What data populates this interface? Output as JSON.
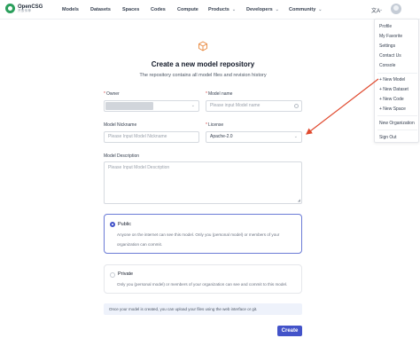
{
  "brand": {
    "name": "OpenCSG",
    "tagline": "开放传神"
  },
  "nav": {
    "items": [
      "Models",
      "Datasets",
      "Spaces",
      "Codes",
      "Compute"
    ],
    "dropdowns": [
      "Products",
      "Developers",
      "Community"
    ],
    "language_icon": "translate-icon",
    "avatar_icon": "user-avatar"
  },
  "user_menu": {
    "items": [
      "Profile",
      "My Favorite",
      "Settings",
      "Contact Us",
      "Console"
    ],
    "new_items": [
      "+ New Model",
      "+ New Dataset",
      "+ New Code",
      "+ New Space"
    ],
    "org_item": "New Organization",
    "signout": "Sign Out"
  },
  "page": {
    "icon": "cube-icon",
    "title": "Create a new model repository",
    "subtitle": "The repository contains all model files and revision history"
  },
  "form": {
    "owner": {
      "label": "Owner",
      "required_mark": "*"
    },
    "model_name": {
      "label": "Model name",
      "required_mark": "*",
      "placeholder": "Please input Model name"
    },
    "nickname": {
      "label": "Model Nickname",
      "placeholder": "Please Input Model Nickname"
    },
    "license": {
      "label": "License",
      "required_mark": "*",
      "value": "Apache-2.0"
    },
    "description": {
      "label": "Model Description",
      "placeholder": "Please Input Model Description"
    }
  },
  "visibility": {
    "selected": "public",
    "public": {
      "title": "Public",
      "desc": "Anyone on the internet can see this model. Only you (personal model) or members of your organization can commit."
    },
    "private": {
      "title": "Private",
      "desc": "Only you (personal model) or members of your organization can see and commit to this model."
    },
    "notice": "Once your model is created, you can upload your files using the web interface or git."
  },
  "actions": {
    "create": "Create"
  },
  "colors": {
    "accent": "#4353c9",
    "annotation_arrow": "#e04a2f",
    "brand_green": "#2b9f5c"
  }
}
